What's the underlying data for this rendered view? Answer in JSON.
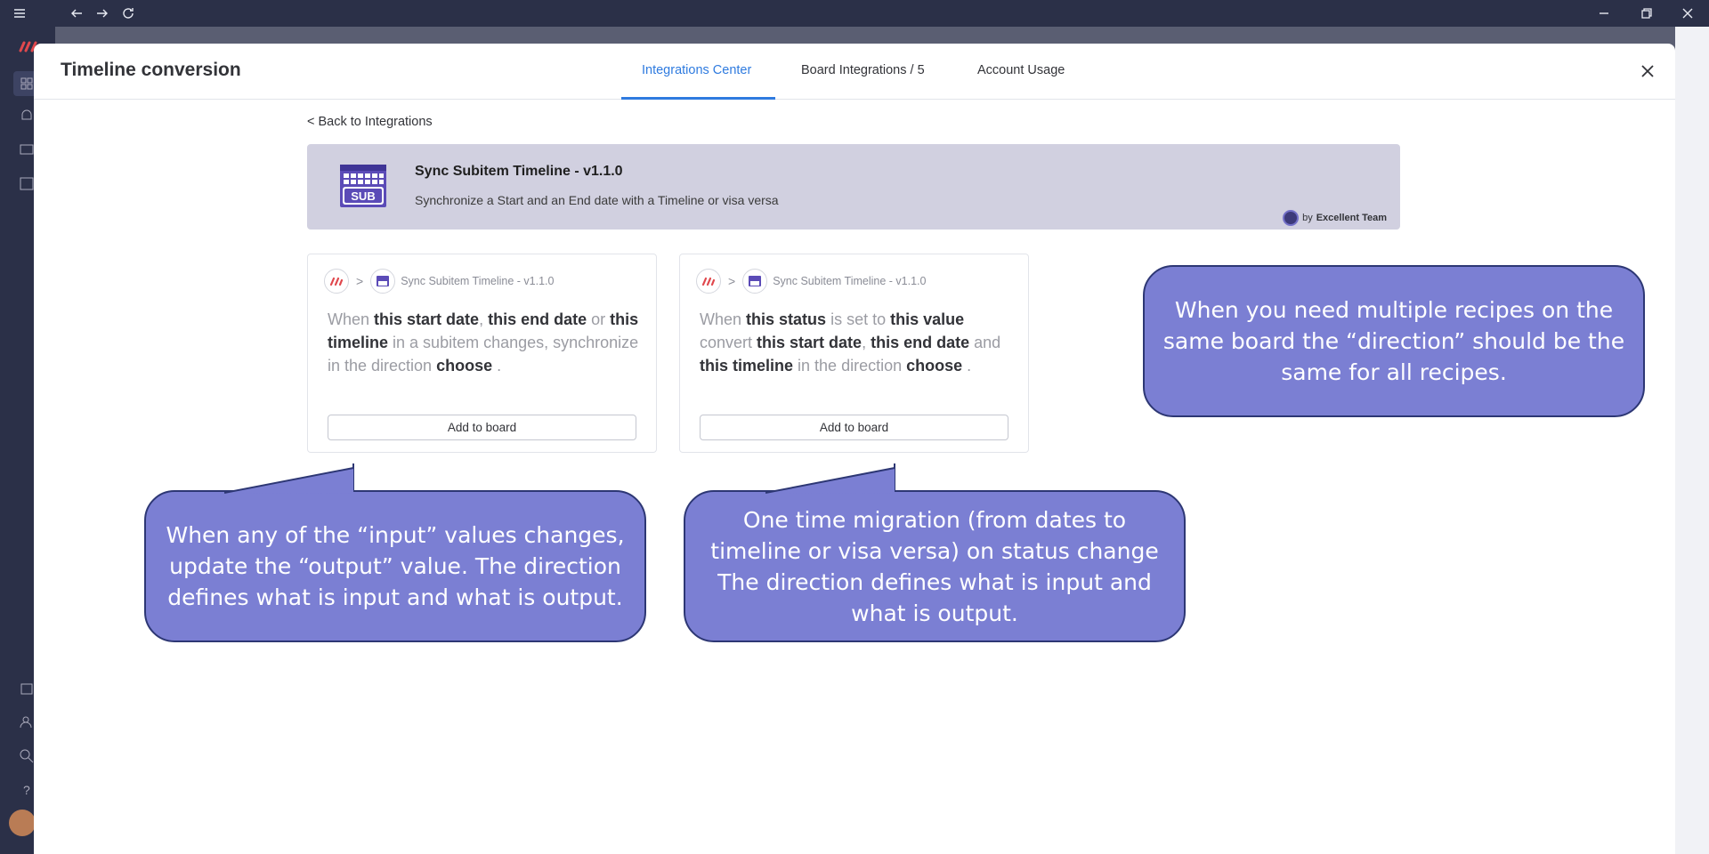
{
  "chrome": {
    "icons": [
      "menu-icon",
      "back-arrow-icon",
      "forward-arrow-icon",
      "reload-icon",
      "minimize-icon",
      "restore-icon",
      "close-window-icon"
    ]
  },
  "modal": {
    "title": "Timeline conversion",
    "tabs": [
      {
        "label": "Integrations Center",
        "active": true
      },
      {
        "label": "Board Integrations / 5",
        "active": false
      },
      {
        "label": "Account Usage",
        "active": false
      }
    ]
  },
  "back_link": "< Back to Integrations",
  "banner": {
    "logo_text": "SUB",
    "title": "Sync Subitem Timeline - v1.1.0",
    "description": "Synchronize a Start and an End date with a Timeline or visa versa",
    "by_prefix": "by",
    "by_name": "Excellent Team"
  },
  "recipes": [
    {
      "breadcrumb": "Sync Subitem Timeline - v1.1.0",
      "button": "Add to board",
      "text": {
        "p1": "When ",
        "b1": "this start date",
        "p2": ", ",
        "b2": "this end date",
        "p3": " or ",
        "b3": "this timeline",
        "p4": " in a subitem changes, synchronize in the direction ",
        "b4": "choose",
        "p5": " ."
      }
    },
    {
      "breadcrumb": "Sync Subitem Timeline - v1.1.0",
      "button": "Add to board",
      "text": {
        "p1": "When ",
        "b1": "this status",
        "p2": " is set to ",
        "b2": "this value",
        "p3": " convert ",
        "b3": "this start date",
        "p4": ", ",
        "b4": "this end date",
        "p5": " and ",
        "b5": "this timeline",
        "p6": " in the direction ",
        "b6": "choose",
        "p7": " ."
      }
    }
  ],
  "callouts": {
    "left": "When any of the “input” values changes, update the “output” value. The direction defines what is input and what is output.",
    "middle": "One time migration (from dates to timeline or visa versa) on status change The direction defines what is input and what is output.",
    "right": "When you need multiple recipes on the same board the “direction” should be the same for all recipes."
  },
  "colors": {
    "accent": "#2f7bdf",
    "callout_fill": "#7b7fd3",
    "callout_border": "#2d3774",
    "banner_bg": "#d1d0e0",
    "logo_purple": "#5b4bb7"
  }
}
